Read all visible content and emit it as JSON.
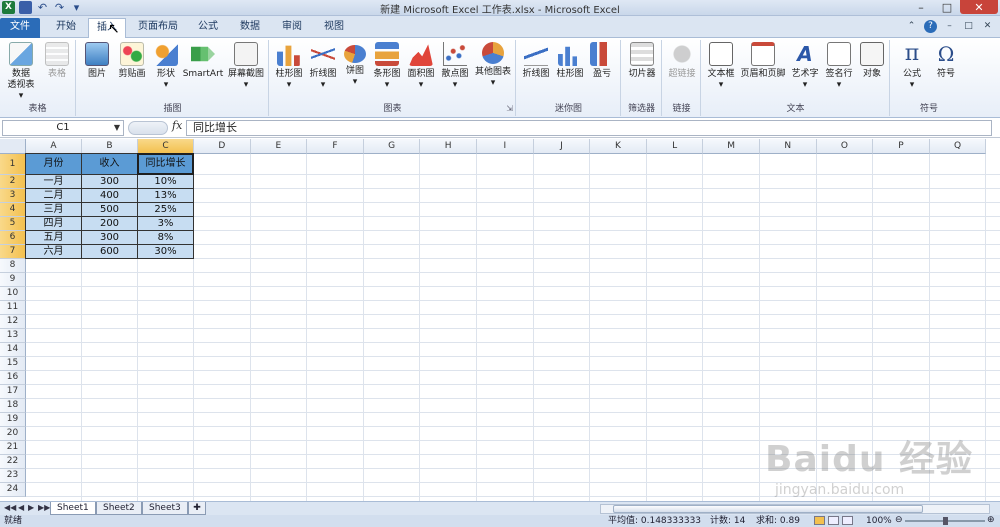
{
  "window": {
    "title": "新建 Microsoft Excel 工作表.xlsx - Microsoft Excel",
    "controls": [
      "–",
      "□",
      "✕"
    ]
  },
  "tabs": {
    "file": "文件",
    "items": [
      "开始",
      "插入",
      "页面布局",
      "公式",
      "数据",
      "审阅",
      "视图"
    ],
    "active": "插入"
  },
  "ribbon": {
    "groups": [
      {
        "label": "表格",
        "buttons": [
          {
            "label": "数据",
            "sub": "透视表 ▾"
          },
          {
            "label": "表格",
            "disabled": true
          }
        ]
      },
      {
        "label": "插图",
        "buttons": [
          {
            "label": "图片"
          },
          {
            "label": "剪贴画"
          },
          {
            "label": "形状",
            "sub": "▾"
          },
          {
            "label": "SmartArt"
          },
          {
            "label": "屏幕截图",
            "sub": "▾"
          }
        ]
      },
      {
        "label": "图表",
        "buttons": [
          {
            "label": "柱形图",
            "sub": "▾"
          },
          {
            "label": "折线图",
            "sub": "▾"
          },
          {
            "label": "饼图",
            "sub": "▾"
          },
          {
            "label": "条形图",
            "sub": "▾"
          },
          {
            "label": "面积图",
            "sub": "▾"
          },
          {
            "label": "散点图",
            "sub": "▾"
          },
          {
            "label": "其他图表",
            "sub": "▾"
          }
        ]
      },
      {
        "label": "迷你图",
        "buttons": [
          {
            "label": "折线图"
          },
          {
            "label": "柱形图"
          },
          {
            "label": "盈亏"
          }
        ]
      },
      {
        "label": "筛选器",
        "buttons": [
          {
            "label": "切片器"
          }
        ]
      },
      {
        "label": "链接",
        "buttons": [
          {
            "label": "超链接",
            "disabled": true
          }
        ]
      },
      {
        "label": "文本",
        "buttons": [
          {
            "label": "文本框",
            "sub": "▾"
          },
          {
            "label": "页眉和页脚"
          },
          {
            "label": "艺术字",
            "sub": "▾"
          },
          {
            "label": "签名行",
            "sub": "▾"
          },
          {
            "label": "对象"
          }
        ]
      },
      {
        "label": "符号",
        "buttons": [
          {
            "label": "公式",
            "sub": "▾"
          },
          {
            "label": "符号"
          }
        ]
      }
    ]
  },
  "formula_bar": {
    "name_box": "C1",
    "fx": "fx",
    "value": "同比增长"
  },
  "grid": {
    "columns": [
      "A",
      "B",
      "C",
      "D",
      "E",
      "F",
      "G",
      "H",
      "I",
      "J",
      "K",
      "L",
      "M",
      "N",
      "O",
      "P",
      "Q"
    ],
    "rows": [
      "1",
      "2",
      "3",
      "4",
      "5",
      "6",
      "7",
      "8",
      "9",
      "10",
      "11",
      "12",
      "13",
      "14",
      "15",
      "16",
      "17",
      "18",
      "19",
      "20",
      "21",
      "22",
      "23",
      "24"
    ],
    "selected_column": "C",
    "table": {
      "headers": [
        "月份",
        "收入",
        "同比增长"
      ],
      "rows": [
        [
          "一月",
          "300",
          "10%"
        ],
        [
          "二月",
          "400",
          "13%"
        ],
        [
          "三月",
          "500",
          "25%"
        ],
        [
          "四月",
          "200",
          "3%"
        ],
        [
          "五月",
          "300",
          "8%"
        ],
        [
          "六月",
          "600",
          "30%"
        ]
      ]
    }
  },
  "sheets": {
    "items": [
      "Sheet1",
      "Sheet2",
      "Sheet3"
    ],
    "active": "Sheet1",
    "nav": [
      "◀◀",
      "◀",
      "▶",
      "▶▶"
    ]
  },
  "status": {
    "ready": "就绪",
    "average": "平均值: 0.148333333",
    "count": "计数: 14",
    "sum": "求和: 0.89",
    "zoom": "100%",
    "zoom_minus": "⊖",
    "zoom_plus": "⊕"
  },
  "watermark": {
    "main": "Baidu 经验",
    "sub": "jingyan.baidu.com"
  },
  "colors": {
    "header_fill": "#5b9bd5",
    "body_fill": "#c7ddf2",
    "selected_header": "#f3c04f",
    "file_tab": "#2b6cb8"
  }
}
